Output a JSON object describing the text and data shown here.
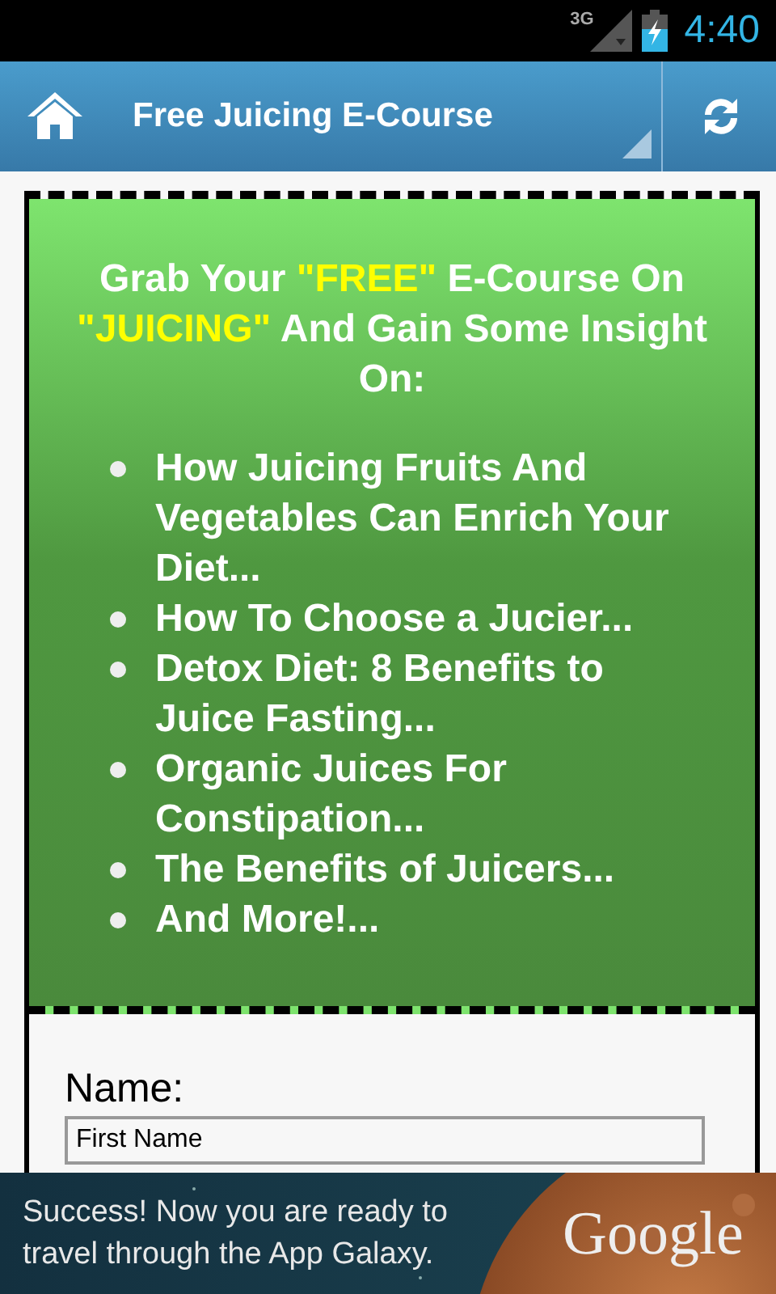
{
  "status_bar": {
    "network": "3G",
    "time": "4:40"
  },
  "action_bar": {
    "title": "Free Juicing E-Course"
  },
  "promo": {
    "heading": [
      {
        "text": "Grab Your ",
        "highlight": false
      },
      {
        "text": "\"FREE\"",
        "highlight": true
      },
      {
        "text": " E-Course On ",
        "highlight": false
      },
      {
        "text": "\"JUICING\"",
        "highlight": true
      },
      {
        "text": " And Gain Some Insight On:",
        "highlight": false
      }
    ],
    "bullets": [
      "How Juicing Fruits And Vegetables Can Enrich Your Diet...",
      "How To Choose a Jucier...",
      "Detox Diet: 8 Benefits to Juice Fasting...",
      "Organic Juices For Constipation...",
      "The Benefits of Juicers...",
      "And More!..."
    ]
  },
  "form": {
    "label": "Name:",
    "field": {
      "value": "First Name"
    }
  },
  "ad": {
    "text": "Success! Now you are ready to travel through the App Galaxy.",
    "logo_text": "Google"
  }
}
